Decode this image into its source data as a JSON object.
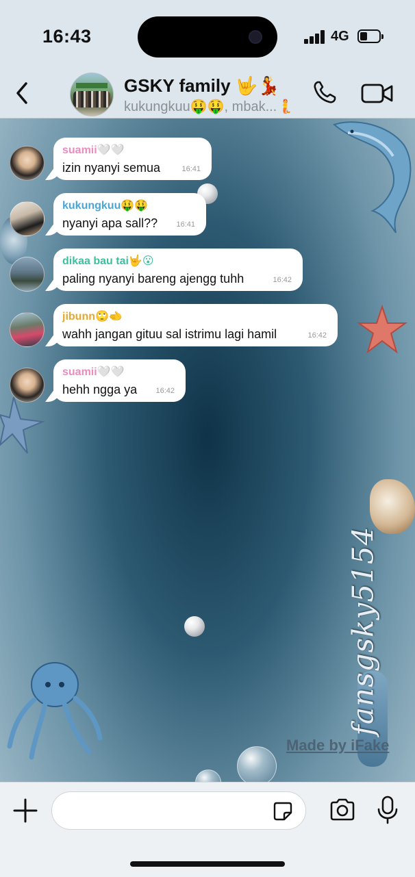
{
  "status": {
    "time": "16:43",
    "network": "4G",
    "battery_level": 0.4
  },
  "header": {
    "title": "GSKY family 🤟💃",
    "subtitle": "kukungkuu🤑🤑, mbak...🧜",
    "back_icon": "chevron-left-icon",
    "call_icon": "phone-icon",
    "video_icon": "video-camera-icon"
  },
  "messages": [
    {
      "sender": "suamii🤍🤍",
      "sender_color": "#e98cc0",
      "text": "izin nyanyi semua",
      "time": "16:41"
    },
    {
      "sender": "kukungkuu🤑🤑",
      "sender_color": "#4aa6d8",
      "text": "nyanyi apa sall??",
      "time": "16:41"
    },
    {
      "sender": "dikaa bau tai🤟😮",
      "sender_color": "#3cc0a0",
      "text": "paling nyanyi bareng ajengg tuhh",
      "time": "16:42"
    },
    {
      "sender": "jibunn🙄🫲",
      "sender_color": "#e3a832",
      "text": "wahh jangan gituu sal istrimu lagi hamil",
      "time": "16:42"
    },
    {
      "sender": "suamii🤍🤍",
      "sender_color": "#e98cc0",
      "text": "hehh ngga ya",
      "time": "16:42"
    }
  ],
  "watermark": "Made by iFake",
  "signature": "fansgsky5154",
  "composer": {
    "placeholder": "",
    "value": ""
  }
}
